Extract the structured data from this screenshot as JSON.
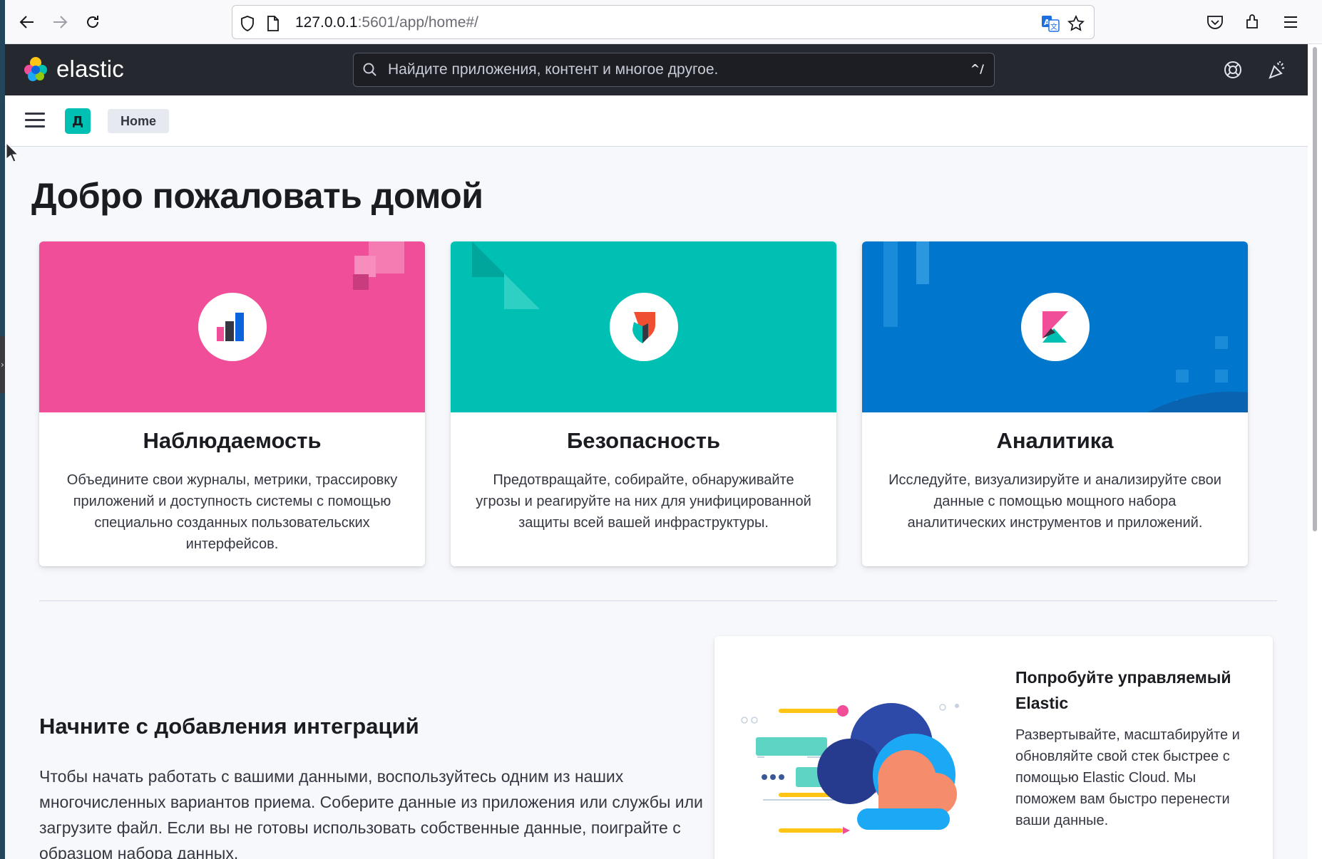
{
  "browser": {
    "url_host": "127.0.0.1",
    "url_path": ":5601/app/home#/"
  },
  "header": {
    "logo_text": "elastic",
    "search_placeholder": "Найдите приложения, контент и многое другое.",
    "search_shortcut": "^/"
  },
  "subheader": {
    "space_initial": "Д",
    "breadcrumb": "Home"
  },
  "main": {
    "title": "Добро пожаловать домой",
    "cards": [
      {
        "title": "Наблюдаемость",
        "description": "Объедините свои журналы, метрики, трассировку приложений и доступность системы с помощью специально созданных пользовательских интерфейсов.",
        "color": "#f04e98"
      },
      {
        "title": "Безопасность",
        "description": "Предотвращайте, собирайте, обнаруживайте угрозы и реагируйте на них для унифицированной защиты всей вашей инфраструктуры.",
        "color": "#00bfb3"
      },
      {
        "title": "Аналитика",
        "description": "Исследуйте, визуализируйте и анализируйте свои данные с помощью мощного набора аналитических инструментов и приложений.",
        "color": "#0077cc"
      }
    ],
    "integrations": {
      "title": "Начните с добавления интеграций",
      "text": "Чтобы начать работать с вашими данными, воспользуйтесь одним из наших многочисленных вариантов приема. Соберите данные из приложения или службы или загрузите файл. Если вы не готовы использовать собственные данные, поиграйте с образцом набора данных."
    },
    "cloud": {
      "title": "Попробуйте управляемый Elastic",
      "text": "Развертывайте, масштабируйте и обновляйте свой стек быстрее с помощью Elastic Cloud. Мы поможем вам быстро перенести ваши данные."
    }
  }
}
